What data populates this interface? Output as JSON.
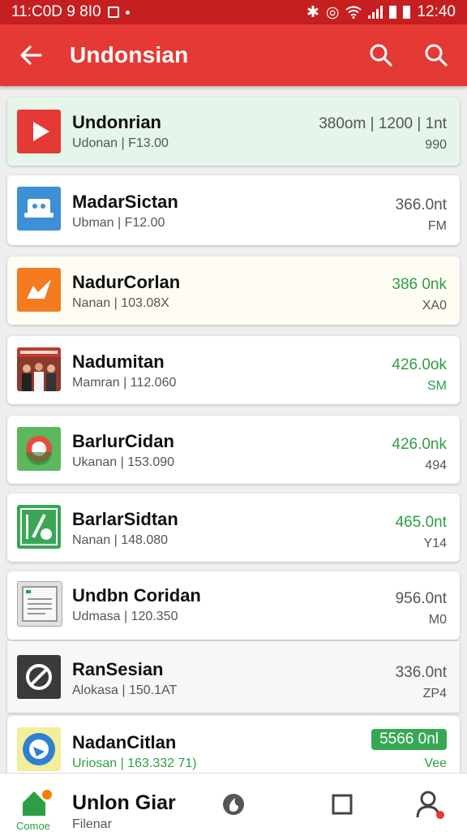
{
  "status_bar": {
    "left_text": "11:C0D 9 8I0",
    "time": "12:40"
  },
  "app_bar": {
    "title": "Undonsian"
  },
  "items": [
    {
      "name": "Undonrian",
      "subtitle": "Udonan | F13.00",
      "size": "380om | 1200 | 1nt",
      "tag": "990"
    },
    {
      "name": "MadarSictan",
      "subtitle": "Ubman | F12.00",
      "size": "366.0nt",
      "tag": "FM"
    },
    {
      "name": "NadurCorlan",
      "subtitle": "Nanan | 103.08X",
      "size": "386 0nk",
      "tag": "XA0"
    },
    {
      "name": "Nadumitan",
      "subtitle": "Mamran | 112.060",
      "size": "426.0ok",
      "tag": "SM"
    },
    {
      "name": "BarlurCidan",
      "subtitle": "Ukanan | 153.090",
      "size": "426.0nk",
      "tag": "494"
    },
    {
      "name": "BarlarSidtan",
      "subtitle": "Nanan | 148.080",
      "size": "465.0nt",
      "tag": "Y14"
    },
    {
      "name": "Undbn Coridan",
      "subtitle": "Udmasa | 120.350",
      "size": "956.0nt",
      "tag": "M0"
    },
    {
      "name": "RanSesian",
      "subtitle": "Alokasa | 150.1AT",
      "size": "336.0nt",
      "tag": "ZP4"
    },
    {
      "name": "NadanCitlan",
      "subtitle": "Uriosan | 163.332 71)",
      "size": "5566 0nl",
      "tag": "Vee"
    }
  ],
  "bottom_nav": {
    "home_label": "Comoe",
    "title": "Unlon Giar",
    "subtitle": "Filenar"
  },
  "colors": {
    "status_bar": "#c61f1f",
    "app_bar": "#e53935",
    "highlight_green": "#e6f5ea",
    "highlight_yellow": "#fffdf3",
    "accent_green": "#2e9e44"
  }
}
